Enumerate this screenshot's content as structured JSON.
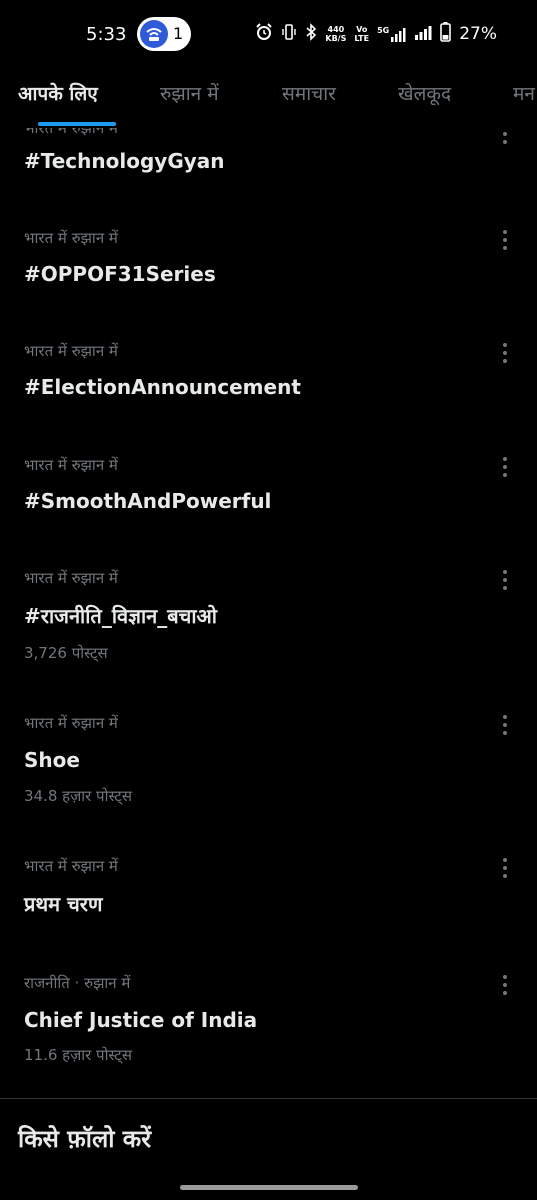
{
  "status_bar": {
    "time": "5:33",
    "hotspot_count": "1",
    "net_speed_top": "440",
    "net_speed_unit": "KB/S",
    "volte_top": "Vo",
    "volte_bottom": "LTE",
    "network_type": "5G",
    "battery": "27%"
  },
  "tabs": [
    {
      "label": "आपके लिए",
      "active": true
    },
    {
      "label": "रुझान में",
      "active": false
    },
    {
      "label": "समाचार",
      "active": false
    },
    {
      "label": "खेलकूद",
      "active": false
    },
    {
      "label": "मन",
      "active": false
    }
  ],
  "partial_context": "भारत में रुझान में",
  "trends": [
    {
      "context": "",
      "title": "#TechnologyGyan",
      "count": ""
    },
    {
      "context": "भारत में रुझान में",
      "title": "#OPPOF31Series",
      "count": ""
    },
    {
      "context": "भारत में रुझान में",
      "title": "#ElectionAnnouncement",
      "count": ""
    },
    {
      "context": "भारत में रुझान में",
      "title": "#SmoothAndPowerful",
      "count": ""
    },
    {
      "context": "भारत में रुझान में",
      "title": "#राजनीति_विज्ञान_बचाओ",
      "count": "3,726 पोस्ट्स"
    },
    {
      "context": "भारत में रुझान में",
      "title": "Shoe",
      "count": "34.8 हज़ार पोस्ट्स"
    },
    {
      "context": "भारत में रुझान में",
      "title": "प्रथम चरण",
      "count": ""
    },
    {
      "context": "राजनीति · रुझान में",
      "title": "Chief Justice of India",
      "count": "11.6 हज़ार पोस्ट्स"
    }
  ],
  "who_to_follow_title": "किसे फ़ॉलो करें",
  "colors": {
    "background": "#000000",
    "accent": "#1d9bf0",
    "secondary_text": "#71767b",
    "primary_text": "#e7e9ea"
  }
}
